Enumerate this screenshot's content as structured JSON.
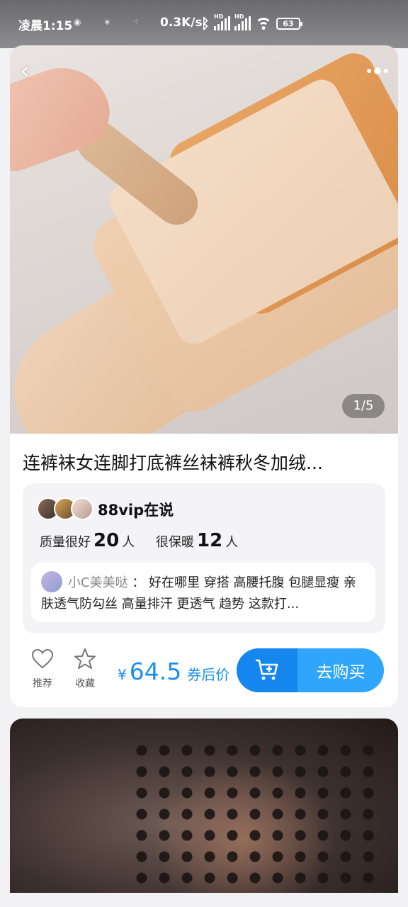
{
  "status_bar": {
    "time": "凌晨1:15",
    "net_speed": "0.3K/s",
    "signal_hd_label": "HD",
    "battery": "63"
  },
  "gallery": {
    "counter": "1/5"
  },
  "product": {
    "title": "连裤袜女连脚打底裤丝袜裤秋冬加绒..."
  },
  "reviews": {
    "header": "88vip在说",
    "stats": [
      {
        "label": "质量很好",
        "count": "20",
        "unit": "人"
      },
      {
        "label": "很保暖",
        "count": "12",
        "unit": "人"
      }
    ],
    "comment": {
      "user": "小C美美哒",
      "separator": "：",
      "text": "好在哪里 穿搭 高腰托腹 包腿显瘦 亲肤透气防勾丝 高量排汗 更透气 趋势 这款打..."
    }
  },
  "actions": {
    "recommend_label": "推荐",
    "favorite_label": "收藏"
  },
  "price": {
    "currency": "¥",
    "value": "64.5",
    "tag": "券后价"
  },
  "buy_button": {
    "label": "去购买"
  },
  "colors": {
    "accent": "#1b8ff0",
    "buy_dark": "#1486ee",
    "buy_light": "#2fa6fb"
  }
}
